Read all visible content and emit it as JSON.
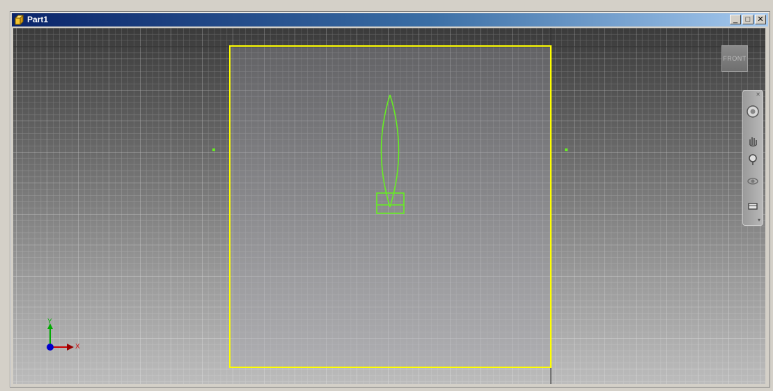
{
  "window": {
    "title": "Part1",
    "buttons": {
      "minimize": "_",
      "maximize": "□",
      "close": "✕"
    }
  },
  "viewcube": {
    "face_label": "FRONT"
  },
  "axis_triad": {
    "x_label": "X",
    "y_label": "Y"
  },
  "colors": {
    "title_bar_start": "#0a246a",
    "title_bar_end": "#a6caf0",
    "sketch_boundary": "#ffff00",
    "sketch_geometry": "#66ee22",
    "x_axis": "#cc0000",
    "y_axis": "#00aa00",
    "origin_point": "#0000cc"
  },
  "navigation_bar": {
    "tools": [
      "steering-wheel-icon",
      "pan-icon",
      "zoom-icon",
      "orbit-icon",
      "look-at-icon"
    ]
  }
}
